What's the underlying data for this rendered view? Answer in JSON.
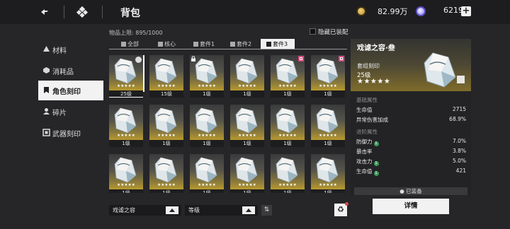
{
  "topbar": {
    "title": "背包",
    "currency1": "82.99万",
    "currency2": "6219",
    "plus": "+"
  },
  "sidebar": {
    "items": [
      {
        "label": "材料",
        "icon": "materials-icon"
      },
      {
        "label": "消耗品",
        "icon": "consumables-icon"
      },
      {
        "label": "角色刻印",
        "icon": "character-imprint-icon",
        "active": true
      },
      {
        "label": "碎片",
        "icon": "fragment-icon"
      },
      {
        "label": "武器刻印",
        "icon": "weapon-imprint-icon"
      }
    ]
  },
  "inventory": {
    "capacity": "物品上限: 895/1000",
    "hide_equipped": "隐藏已装配"
  },
  "tabs": [
    {
      "label": "全部"
    },
    {
      "label": "核心"
    },
    {
      "label": "套件1"
    },
    {
      "label": "套件2"
    },
    {
      "label": "套件3",
      "active": true
    }
  ],
  "grid": {
    "stars": "★★★★★",
    "levels": [
      "25级",
      "15级",
      "1级",
      "1级",
      "1级",
      "1级",
      "1级",
      "1级",
      "1级",
      "1级",
      "1级",
      "1级",
      "1级",
      "1级",
      "1级",
      "1级",
      "1级",
      "1级"
    ]
  },
  "bottom": {
    "filter_value": "戏谑之容",
    "sort_value": "等级",
    "sort_order_icon": "⇅",
    "recycle_icon": "♻"
  },
  "detail": {
    "name": "戏谑之容·叁",
    "type": "套组刻印",
    "level": "25级",
    "stars": "★★★★★",
    "base_title": "基础属性",
    "base_stats": [
      {
        "k": "生命值",
        "v": "2715"
      },
      {
        "k": "异常伤害加成",
        "v": "68.9%"
      }
    ],
    "adv_title": "进阶属性",
    "adv_stats": [
      {
        "k": "防御力",
        "badge": "1",
        "v": "7.0%"
      },
      {
        "k": "暴击率",
        "badge": "",
        "v": "3.8%"
      },
      {
        "k": "攻击力",
        "badge": "1",
        "v": "5.0%"
      },
      {
        "k": "生命值",
        "badge": "1",
        "v": "421"
      }
    ],
    "equipped_label": "已装备",
    "details_button": "详情"
  },
  "colors": {
    "bg": "#262629",
    "accent_gold": "#b8992e",
    "active_tab": "#f0f0f0",
    "badge_pink": "#d84a7e",
    "stat_up_green": "#3d9a5c"
  }
}
